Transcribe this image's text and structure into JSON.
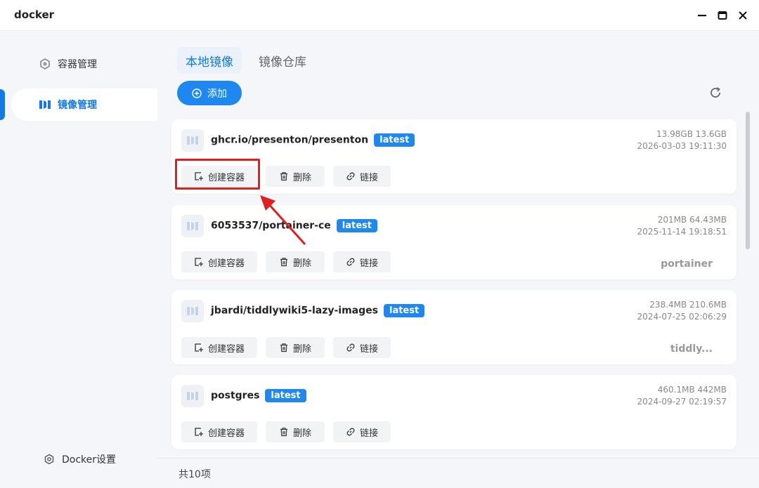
{
  "window": {
    "title": "docker"
  },
  "sidebar": {
    "items": [
      {
        "label": "容器管理",
        "icon": "hexagon-icon",
        "active": false
      },
      {
        "label": "镜像管理",
        "icon": "image-icon",
        "active": true
      }
    ],
    "settings_label": "Docker设置"
  },
  "tabs": [
    {
      "label": "本地镜像",
      "active": true
    },
    {
      "label": "镜像仓库",
      "active": false
    }
  ],
  "toolbar": {
    "add_label": "添加"
  },
  "actions": {
    "create_label": "创建容器",
    "delete_label": "删除",
    "link_label": "链接"
  },
  "images": [
    {
      "name": "ghcr.io/presenton/presenton",
      "tag": "latest",
      "size": "13.98GB 13.6GB",
      "date": "2026-03-03 19:11:30",
      "container": ""
    },
    {
      "name": "6053537/portainer-ce",
      "tag": "latest",
      "size": "201MB 64.43MB",
      "date": "2025-11-14 19:18:51",
      "container": "portainer"
    },
    {
      "name": "jbardi/tiddlywiki5-lazy-images",
      "tag": "latest",
      "size": "238.4MB 210.6MB",
      "date": "2024-07-25 02:06:29",
      "container": "tiddly..."
    },
    {
      "name": "postgres",
      "tag": "latest",
      "size": "460.1MB 442MB",
      "date": "2024-09-27 02:19:57",
      "container": ""
    }
  ],
  "footer": {
    "count_label": "共10项"
  },
  "colors": {
    "accent": "#1e88f0",
    "annotation": "#e02020",
    "background": "#f4f6f9"
  }
}
